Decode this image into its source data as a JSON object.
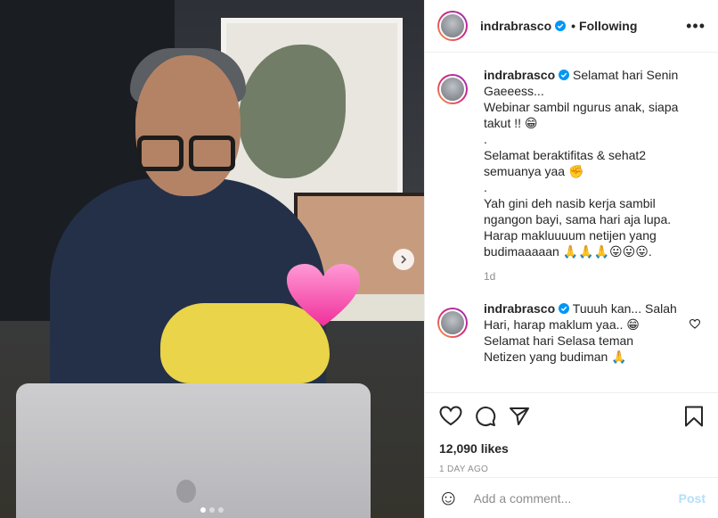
{
  "header": {
    "username": "indrabrasco",
    "follow_sep": "•",
    "follow_label": "Following",
    "more": "•••"
  },
  "caption": {
    "username": "indrabrasco",
    "lines": [
      "Selamat hari Senin",
      "Gaeeess...",
      "Webinar sambil ngurus anak, siapa",
      "takut !! 😁",
      ".",
      "Selamat beraktifitas & sehat2",
      "semuanya yaa ✊",
      ".",
      "Yah gini deh nasib kerja sambil",
      "ngangon bayi, sama hari aja lupa.",
      "Harap makluuuum netijen yang",
      "budimaaaaan 🙏🙏🙏😛😛😛."
    ],
    "time": "1d"
  },
  "comment": {
    "username": "indrabrasco",
    "lines": [
      "Tuuuh kan... Salah",
      "Hari, harap maklum yaa.. 😁",
      "Selamat hari Selasa teman",
      "Netizen yang budiman 🙏"
    ]
  },
  "stats": {
    "likes": "12,090 likes",
    "date": "1 DAY AGO"
  },
  "add_comment": {
    "placeholder": "Add a comment...",
    "post_label": "Post",
    "emoji": "☺"
  },
  "carousel": {
    "count": 3,
    "active": 0
  },
  "colors": {
    "accent": "#0095f6",
    "post_disabled": "#b2dffc",
    "muted": "#8e8e8e"
  }
}
